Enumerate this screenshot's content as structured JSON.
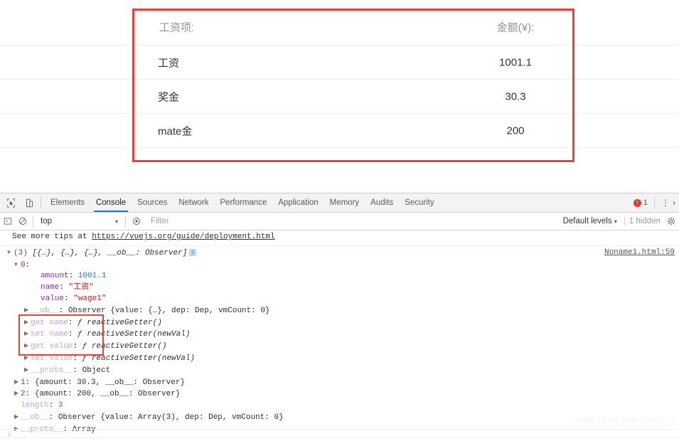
{
  "page": {
    "table": {
      "headers": {
        "name": "工资项:",
        "amount": "金额(¥):"
      },
      "rows": [
        {
          "name": "工资",
          "amount": "1001.1"
        },
        {
          "name": "奖金",
          "amount": "30.3"
        },
        {
          "name": "mate金",
          "amount": "200"
        }
      ]
    },
    "annotation_color": "#e8403a"
  },
  "devtools": {
    "icons": {
      "inspect": "inspect-cursor-icon",
      "device": "device-toolbar-icon"
    },
    "tabs": [
      {
        "label": "Elements",
        "active": false
      },
      {
        "label": "Console",
        "active": true
      },
      {
        "label": "Sources",
        "active": false
      },
      {
        "label": "Network",
        "active": false
      },
      {
        "label": "Performance",
        "active": false
      },
      {
        "label": "Application",
        "active": false
      },
      {
        "label": "Memory",
        "active": false
      },
      {
        "label": "Audits",
        "active": false
      },
      {
        "label": "Security",
        "active": false
      }
    ],
    "active_tab_underline_color": "#1a73e8",
    "error_badge": {
      "count": "1",
      "color": "#e03b33"
    },
    "more_menu": "⋮",
    "overflow_chevron": "›",
    "filterbar": {
      "sidebar_toggle": "console-sidebar-icon",
      "clear_console": "clear-console-icon",
      "context": "top",
      "context_caret": "▾",
      "eye_icon": "live-expression-icon",
      "filter_placeholder": "Filter",
      "levels": "Default levels",
      "levels_caret": "▾",
      "hidden_count": "1 hidden",
      "settings_icon": "gear-icon"
    },
    "console": {
      "tip_prefix": "See more tips at ",
      "tip_link": "https://vuejs.org/guide/deployment.html",
      "source_link": "Noname1.html:59",
      "array_header": {
        "triangle": "▼",
        "count": "(3)",
        "preview": "[{…}, {…}, {…}, __ob__: Observer]"
      },
      "lines": [
        {
          "indent": 1,
          "triangle": "▼",
          "key": "0",
          "sep": ":",
          "value": "",
          "kind": "prop"
        },
        {
          "indent": 3,
          "triangle": "",
          "key": "amount",
          "sep": ": ",
          "value": "1001.1",
          "kind": "num"
        },
        {
          "indent": 3,
          "triangle": "",
          "key": "name",
          "sep": ": ",
          "value": "\"工资\"",
          "kind": "str"
        },
        {
          "indent": 3,
          "triangle": "",
          "key": "value",
          "sep": ": ",
          "value": "\"wage1\"",
          "kind": "str"
        },
        {
          "indent": 2,
          "triangle": "▶",
          "key": "__ob__",
          "sep": ": ",
          "value": "Observer {value: {…}, dep: Dep, vmCount: 0}",
          "kind": "observer"
        },
        {
          "indent": 2,
          "triangle": "▶",
          "key": "get name",
          "sep": ": ",
          "value": "ƒ reactiveGetter()",
          "kind": "fn"
        },
        {
          "indent": 2,
          "triangle": "▶",
          "key": "set name",
          "sep": ": ",
          "value": "ƒ reactiveSetter(newVal)",
          "kind": "fn"
        },
        {
          "indent": 2,
          "triangle": "▶",
          "key": "get value",
          "sep": ": ",
          "value": "ƒ reactiveGetter()",
          "kind": "fn"
        },
        {
          "indent": 2,
          "triangle": "▶",
          "key": "set value",
          "sep": ": ",
          "value": "ƒ reactiveSetter(newVal)",
          "kind": "fn"
        },
        {
          "indent": 2,
          "triangle": "▶",
          "key": "__proto__",
          "sep": ": ",
          "value": "Object",
          "kind": "obj"
        },
        {
          "indent": 1,
          "triangle": "▶",
          "key": "1",
          "sep": ": ",
          "value": "{amount: 30.3, __ob__: Observer}",
          "kind": "entry"
        },
        {
          "indent": 1,
          "triangle": "▶",
          "key": "2",
          "sep": ": ",
          "value": "{amount: 200, __ob__: Observer}",
          "kind": "entry"
        },
        {
          "indent": 1,
          "triangle": "",
          "key": "length",
          "sep": ": ",
          "value": "3",
          "kind": "num"
        },
        {
          "indent": 1,
          "triangle": "▶",
          "key": "__ob__",
          "sep": ": ",
          "value": "Observer {value: Array(3), dep: Dep, vmCount: 0}",
          "kind": "observer2"
        },
        {
          "indent": 1,
          "triangle": "▶",
          "key": "__proto__",
          "sep": ": ",
          "value": "Array",
          "kind": "obj"
        }
      ],
      "prompt": "›"
    }
  },
  "watermark": "https://blog.csdn.net/zc_a"
}
